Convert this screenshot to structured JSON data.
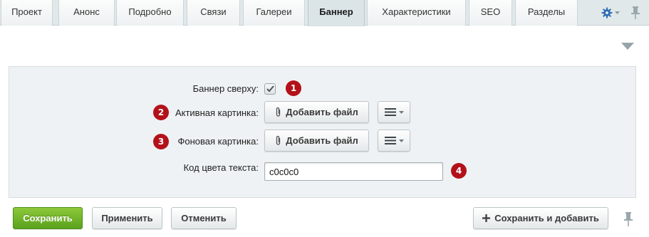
{
  "tabs": [
    {
      "label": "Проект",
      "active": false
    },
    {
      "label": "Анонс",
      "active": false
    },
    {
      "label": "Подробно",
      "active": false
    },
    {
      "label": "Связи",
      "active": false
    },
    {
      "label": "Галереи",
      "active": false
    },
    {
      "label": "Баннер",
      "active": true
    },
    {
      "label": "Характеристики",
      "active": false
    },
    {
      "label": "SEO",
      "active": false
    },
    {
      "label": "Разделы",
      "active": false
    }
  ],
  "form": {
    "banner_top": {
      "label": "Баннер сверху:",
      "checked": true,
      "badge": "1"
    },
    "active_image": {
      "label": "Активная картинка:",
      "button": "Добавить файл",
      "badge": "2"
    },
    "background_image": {
      "label": "Фоновая картинка:",
      "button": "Добавить файл",
      "badge": "3"
    },
    "text_color": {
      "label": "Код цвета текста:",
      "value": "c0c0c0",
      "badge": "4"
    }
  },
  "footer": {
    "save": "Сохранить",
    "apply": "Применить",
    "cancel": "Отменить",
    "save_and_add": "Сохранить и добавить"
  },
  "colors": {
    "accent_green": "#6cb12a",
    "badge_red": "#b3111a",
    "settings_blue": "#2f6fb5"
  },
  "icons": [
    "gear-icon",
    "pin-icon",
    "triangle-down-icon",
    "paperclip-icon",
    "menu-icon",
    "plus-icon",
    "checkmark-icon"
  ]
}
